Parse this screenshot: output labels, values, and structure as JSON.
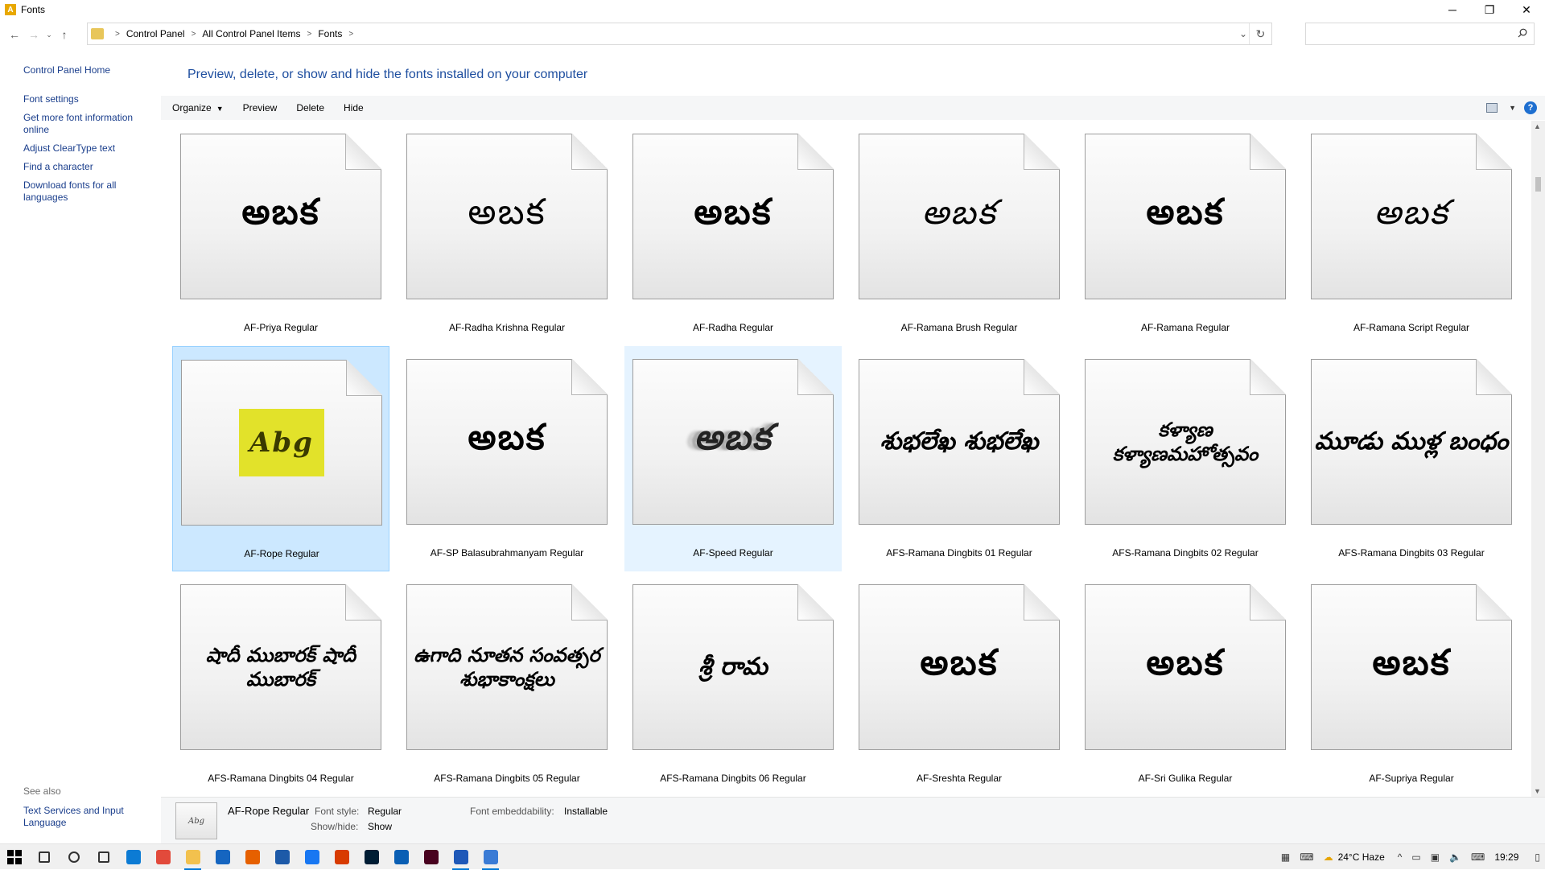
{
  "window": {
    "title": "Fonts",
    "minimize": "─",
    "maximize": "❐",
    "close": "✕"
  },
  "address": {
    "crumbs": [
      "Control Panel",
      "All Control Panel Items",
      "Fonts"
    ],
    "search_placeholder": ""
  },
  "nav": {
    "home": "Control Panel Home",
    "links": [
      "Font settings",
      "Get more font information online",
      "Adjust ClearType text",
      "Find a character",
      "Download fonts for all languages"
    ],
    "see_also": "See also",
    "see_also_link": "Text Services and Input Language"
  },
  "main": {
    "heading": "Preview, delete, or show and hide the fonts installed on your computer"
  },
  "toolbar": {
    "organize": "Organize",
    "preview": "Preview",
    "delete": "Delete",
    "hide": "Hide"
  },
  "fonts": [
    {
      "name": "AF-Priya Regular",
      "sample": "అబక",
      "style": "bold"
    },
    {
      "name": "AF-Radha Krishna Regular",
      "sample": "అబక",
      "style": "light"
    },
    {
      "name": "AF-Radha Regular",
      "sample": "అబక",
      "style": "bold"
    },
    {
      "name": "AF-Ramana Brush Regular",
      "sample": "అబక",
      "style": "script"
    },
    {
      "name": "AF-Ramana Regular",
      "sample": "అబక",
      "style": "bold"
    },
    {
      "name": "AF-Ramana Script Regular",
      "sample": "అబక",
      "style": "script"
    },
    {
      "name": "AF-Rope Regular",
      "sample": "Abg",
      "style": "rope",
      "state": "selected"
    },
    {
      "name": "AF-SP Balasubrahmanyam Regular",
      "sample": "అబక",
      "style": "bold"
    },
    {
      "name": "AF-Speed Regular",
      "sample": "అబక",
      "style": "speed",
      "state": "hovered"
    },
    {
      "name": "AFS-Ramana Dingbits 01 Regular",
      "sample": "శుభలేఖ శుభలేఖ",
      "style": "ding"
    },
    {
      "name": "AFS-Ramana Dingbits 02 Regular",
      "sample": "కళ్యాణ కళ్యాణమహోత్సవం",
      "style": "ding small"
    },
    {
      "name": "AFS-Ramana Dingbits 03 Regular",
      "sample": "మూడు ముళ్ల బంధం",
      "style": "ding"
    },
    {
      "name": "AFS-Ramana Dingbits 04 Regular",
      "sample": "షాదీ ముబారక్ షాదీ ముబారక్",
      "style": "ding small"
    },
    {
      "name": "AFS-Ramana Dingbits 05 Regular",
      "sample": "ఉగాది నూతన సంవత్సర శుభాకాంక్షలు",
      "style": "ding small"
    },
    {
      "name": "AFS-Ramana Dingbits 06 Regular",
      "sample": "శ్రీ రామ",
      "style": "ding"
    },
    {
      "name": "AF-Sreshta Regular",
      "sample": "అబక",
      "style": "bold"
    },
    {
      "name": "AF-Sri Gulika Regular",
      "sample": "అబక",
      "style": "bold"
    },
    {
      "name": "AF-Supriya Regular",
      "sample": "అబక",
      "style": "bold"
    }
  ],
  "details": {
    "thumb": "Abg",
    "name": "AF-Rope Regular",
    "font_style_label": "Font style:",
    "font_style_value": "Regular",
    "show_hide_label": "Show/hide:",
    "show_hide_value": "Show",
    "embed_label": "Font embeddability:",
    "embed_value": "Installable"
  },
  "taskbar": {
    "apps": [
      {
        "name": "search-icon",
        "color": "#333333"
      },
      {
        "name": "cortana-icon",
        "color": "#333333"
      },
      {
        "name": "task-view-icon",
        "color": "#333333"
      },
      {
        "name": "edge-icon",
        "color": "#0c7bd4"
      },
      {
        "name": "chrome-icon",
        "color": "#e24a3b"
      },
      {
        "name": "file-explorer-icon",
        "color": "#f2c14e",
        "active": true
      },
      {
        "name": "mail-icon",
        "color": "#1565c0"
      },
      {
        "name": "firefox-icon",
        "color": "#e66000"
      },
      {
        "name": "store-icon",
        "color": "#1d5aa8"
      },
      {
        "name": "facebook-icon",
        "color": "#1877f2"
      },
      {
        "name": "office-icon",
        "color": "#d83b01"
      },
      {
        "name": "photoshop-icon",
        "color": "#001d34"
      },
      {
        "name": "app-icon",
        "color": "#0a5fb4"
      },
      {
        "name": "indesign-icon",
        "color": "#49021f"
      },
      {
        "name": "fontcreator-icon",
        "color": "#1e58b8",
        "active": true
      },
      {
        "name": "control-panel-icon",
        "color": "#3a7bd5",
        "active": true
      }
    ],
    "weather": "24°C Haze",
    "time": "19:29"
  }
}
